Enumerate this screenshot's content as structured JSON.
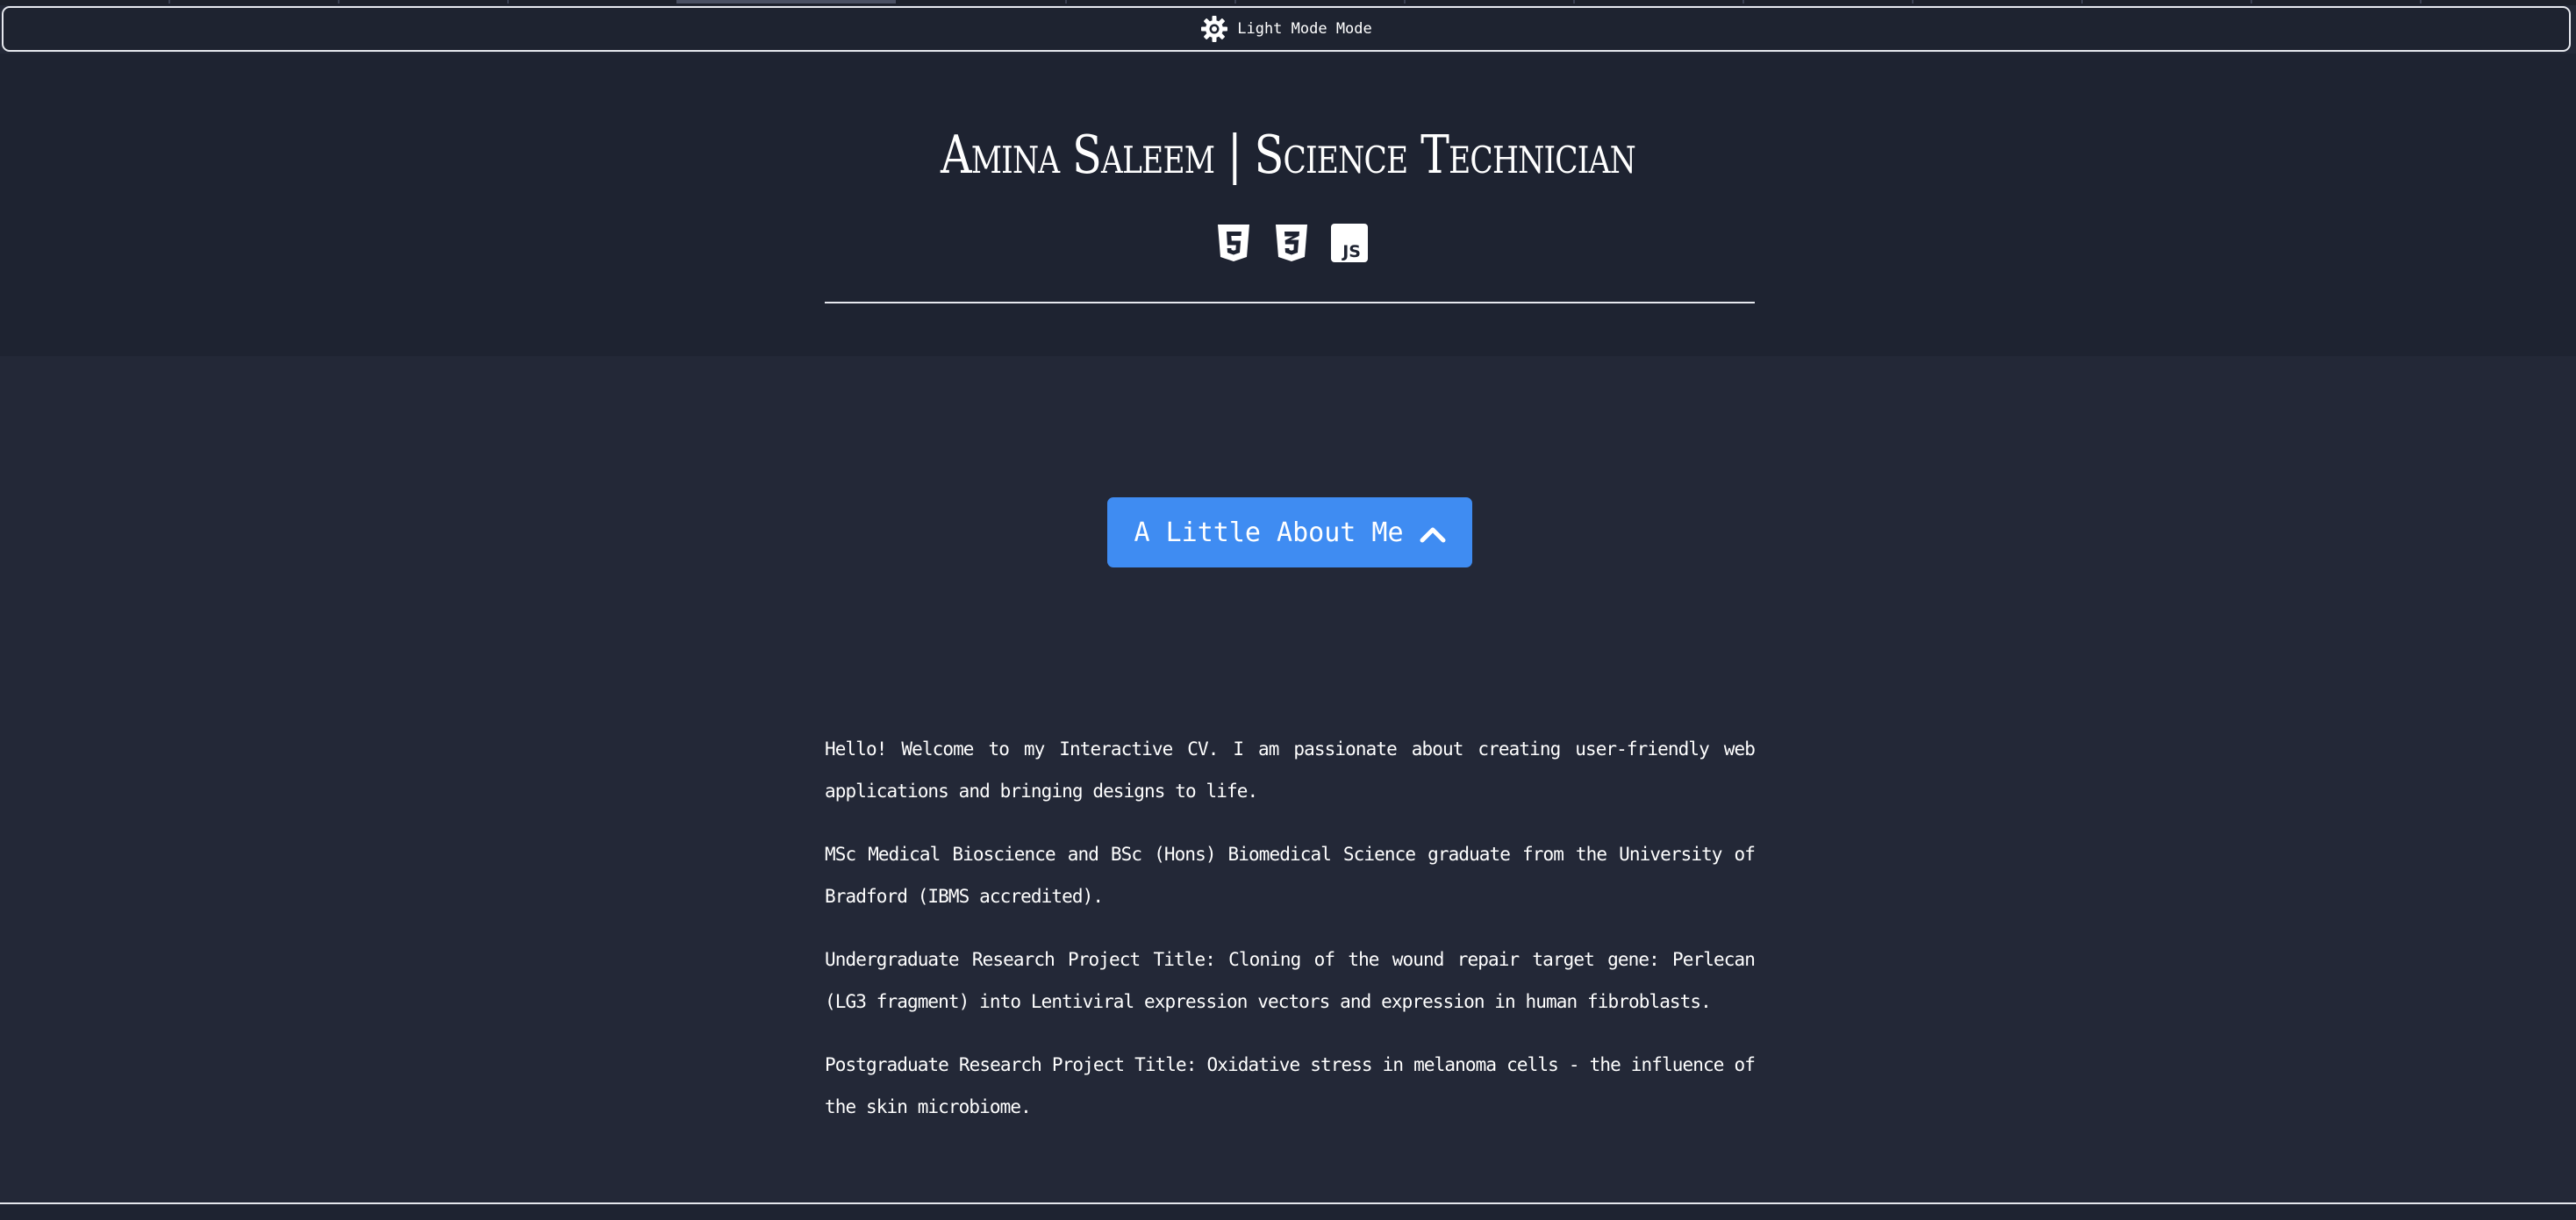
{
  "mode_toggle": {
    "label": "Light Mode Mode",
    "icon": "sun-gear-icon"
  },
  "header": {
    "title": "Amina Saleem | Science Technician",
    "tech_icons": [
      "html5-icon",
      "css3-icon",
      "javascript-icon"
    ]
  },
  "about": {
    "button_label": "A Little About Me",
    "button_icon": "chevron-up-icon",
    "paragraphs": [
      "Hello! Welcome to my Interactive CV. I am passionate about creating user-friendly web applications and bringing designs to life.",
      "MSc Medical Bioscience and BSc (Hons) Biomedical Science graduate from the University of Bradford (IBMS accredited).",
      "Undergraduate Research Project Title: Cloning of the wound repair target gene: Perlecan (LG3 fragment) into Lentiviral expression vectors and expression in human fibroblasts.",
      "Postgraduate Research Project Title: Oxidative stress in melanoma cells - the influence of the skin microbiome."
    ]
  },
  "colors": {
    "background": "#232837",
    "header_background": "#1e2331",
    "accent": "#3f8cf2",
    "text": "#ffffff"
  }
}
